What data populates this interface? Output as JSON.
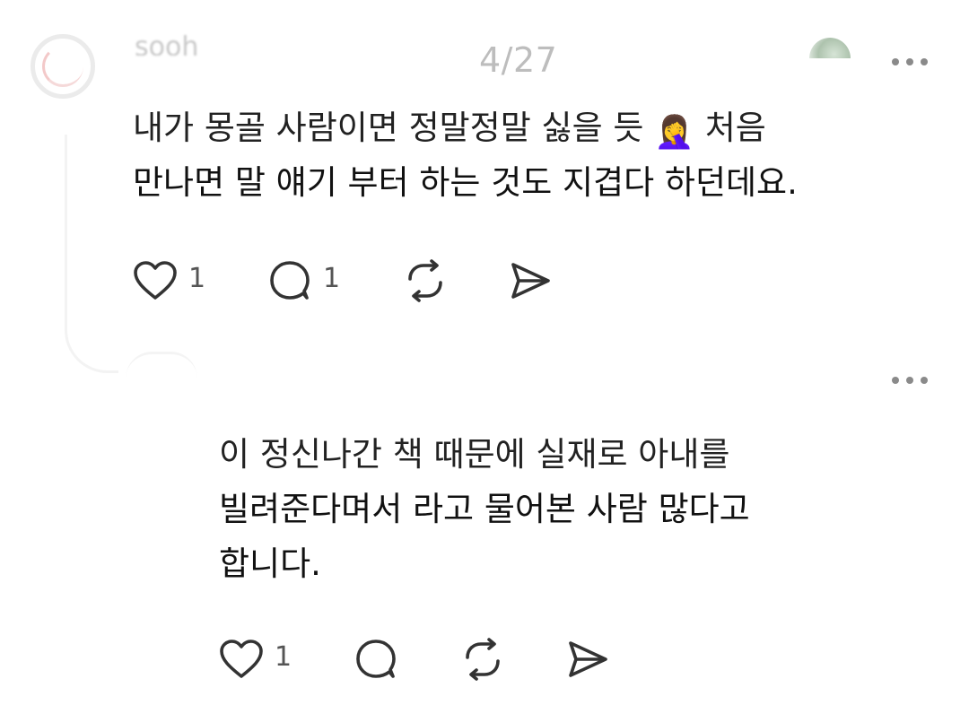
{
  "header": {
    "page_counter": "4/27",
    "faded_name": "sooh"
  },
  "post1": {
    "body_line1": "내가 몽골 사람이면 정말정말 싫을 듯",
    "body_emoji": "🤦‍♀️",
    "body_line1_tail": " 처음",
    "body_line2": "만나면 말 얘기 부터 하는 것도 지겹다 하던데요.",
    "like_count": "1",
    "reply_count": "1"
  },
  "post2": {
    "body_line1": "이 정신나간 책 때문에 실재로 아내를",
    "body_line2": "빌려준다며서 라고 물어본 사람 많다고",
    "body_line3": "합니다.",
    "like_count": "1",
    "reply_count": ""
  },
  "icons": {
    "like": "heart-icon",
    "reply": "comment-bubble-icon",
    "repost": "repost-icon",
    "share": "send-icon",
    "more": "more-dots-icon"
  },
  "colors": {
    "text": "#111111",
    "icon": "#333333",
    "muted": "#bdbdbd"
  }
}
